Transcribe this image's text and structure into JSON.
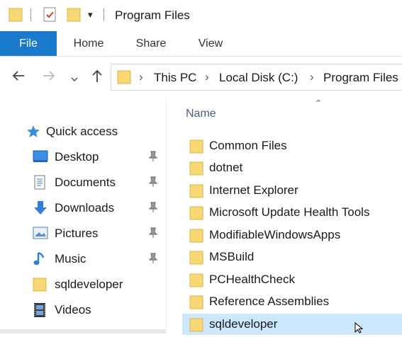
{
  "window": {
    "title": "Program Files"
  },
  "ribbon": {
    "tabs": [
      {
        "label": "File",
        "active": true
      },
      {
        "label": "Home"
      },
      {
        "label": "Share"
      },
      {
        "label": "View"
      }
    ]
  },
  "address": {
    "crumbs": [
      "This PC",
      "Local Disk (C:)",
      "Program Files"
    ]
  },
  "navigation": {
    "quick_access": {
      "label": "Quick access",
      "icon": "star-icon"
    },
    "items": [
      {
        "label": "Desktop",
        "icon": "desktop-icon",
        "pinned": true
      },
      {
        "label": "Documents",
        "icon": "documents-icon",
        "pinned": true
      },
      {
        "label": "Downloads",
        "icon": "downloads-icon",
        "pinned": true
      },
      {
        "label": "Pictures",
        "icon": "pictures-icon",
        "pinned": true
      },
      {
        "label": "Music",
        "icon": "music-icon",
        "pinned": true
      },
      {
        "label": "sqldeveloper",
        "icon": "folder-icon",
        "pinned": false
      },
      {
        "label": "Videos",
        "icon": "videos-icon",
        "pinned": false
      }
    ]
  },
  "filelist": {
    "column_header": "Name",
    "items": [
      {
        "name": "Common Files"
      },
      {
        "name": "dotnet"
      },
      {
        "name": "Internet Explorer"
      },
      {
        "name": "Microsoft Update Health Tools"
      },
      {
        "name": "ModifiableWindowsApps"
      },
      {
        "name": "MSBuild"
      },
      {
        "name": "PCHealthCheck"
      },
      {
        "name": "Reference Assemblies"
      },
      {
        "name": "sqldeveloper",
        "selected": true
      }
    ]
  },
  "colors": {
    "accent": "#1979ca",
    "selection": "#cce8ff",
    "folder": "#f8d775",
    "folder_dark": "#e8b84a"
  }
}
